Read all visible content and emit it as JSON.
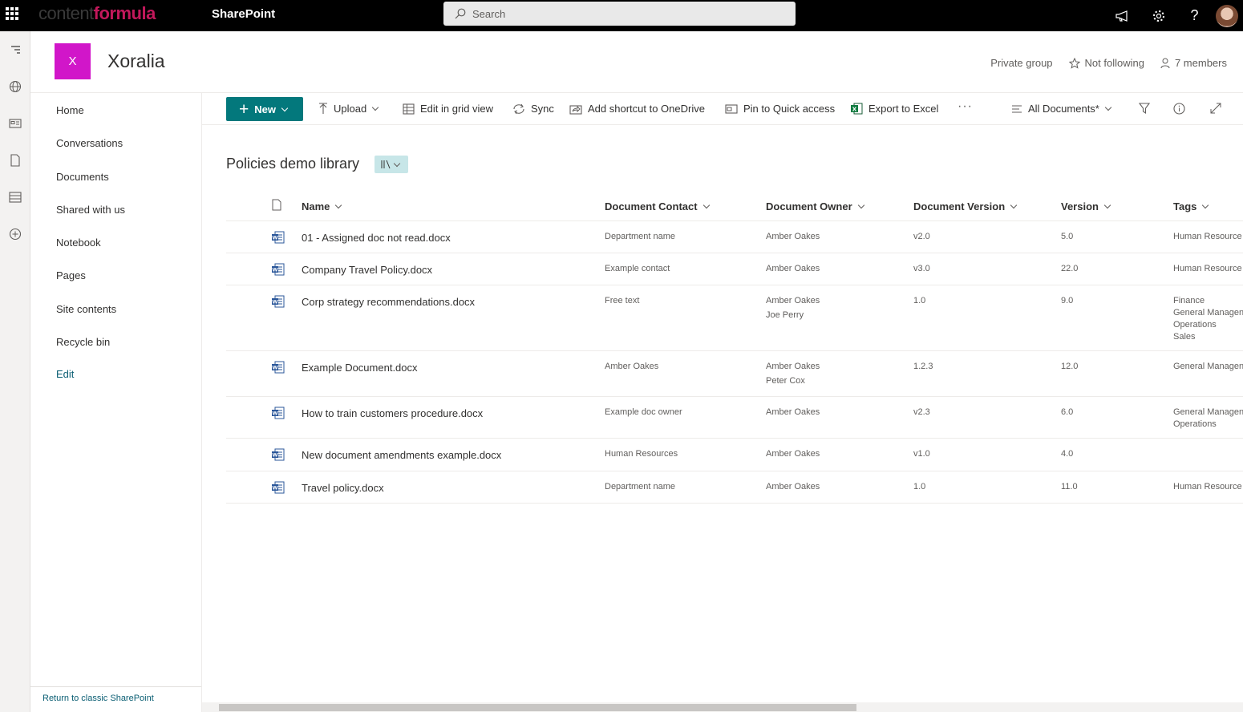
{
  "topbar": {
    "brand_part1": "content",
    "brand_part2": "formula",
    "app_name": "SharePoint",
    "search_placeholder": "Search"
  },
  "site": {
    "logo_letter": "X",
    "title": "Xoralia",
    "privacy": "Private group",
    "follow": "Not following",
    "members": "7 members",
    "accent": "#d116c9"
  },
  "nav": {
    "items": [
      "Home",
      "Conversations",
      "Documents",
      "Shared with us",
      "Notebook",
      "Pages",
      "Site contents",
      "Recycle bin"
    ],
    "edit": "Edit",
    "classic": "Return to classic SharePoint"
  },
  "commands": {
    "new": "New",
    "upload": "Upload",
    "grid": "Edit in grid view",
    "sync": "Sync",
    "shortcut": "Add shortcut to OneDrive",
    "pin": "Pin to Quick access",
    "export": "Export to Excel",
    "view": "All Documents*",
    "primary_color": "#03787c"
  },
  "library": {
    "title": "Policies demo library"
  },
  "columns": {
    "name": "Name",
    "contact": "Document Contact",
    "owner": "Document Owner",
    "docversion": "Document Version",
    "version": "Version",
    "tags": "Tags"
  },
  "rows": [
    {
      "name": "01 - Assigned doc not read.docx",
      "contact": "Department name",
      "owners": [
        "Amber Oakes"
      ],
      "docversion": "v2.0",
      "version": "5.0",
      "tags": [
        "Human Resource"
      ]
    },
    {
      "name": "Company Travel Policy.docx",
      "contact": "Example contact",
      "owners": [
        "Amber Oakes"
      ],
      "docversion": "v3.0",
      "version": "22.0",
      "tags": [
        "Human Resource"
      ]
    },
    {
      "name": "Corp strategy recommendations.docx",
      "contact": "Free text",
      "owners": [
        "Amber Oakes",
        "Joe Perry"
      ],
      "docversion": "1.0",
      "version": "9.0",
      "tags": [
        "Finance",
        "General Managen",
        "Operations",
        "Sales"
      ]
    },
    {
      "name": "Example Document.docx",
      "contact": "Amber Oakes",
      "owners": [
        "Amber Oakes",
        "Peter Cox"
      ],
      "docversion": "1.2.3",
      "version": "12.0",
      "tags": [
        "General Managen"
      ]
    },
    {
      "name": "How to train customers procedure.docx",
      "contact": "Example doc owner",
      "owners": [
        "Amber Oakes"
      ],
      "docversion": "v2.3",
      "version": "6.0",
      "tags": [
        "General Managen",
        "Operations"
      ]
    },
    {
      "name": "New document amendments example.docx",
      "contact": "Human Resources",
      "owners": [
        "Amber Oakes"
      ],
      "docversion": "v1.0",
      "version": "4.0",
      "tags": []
    },
    {
      "name": "Travel policy.docx",
      "contact": "Department name",
      "owners": [
        "Amber Oakes"
      ],
      "docversion": "1.0",
      "version": "11.0",
      "tags": [
        "Human Resource"
      ]
    }
  ]
}
